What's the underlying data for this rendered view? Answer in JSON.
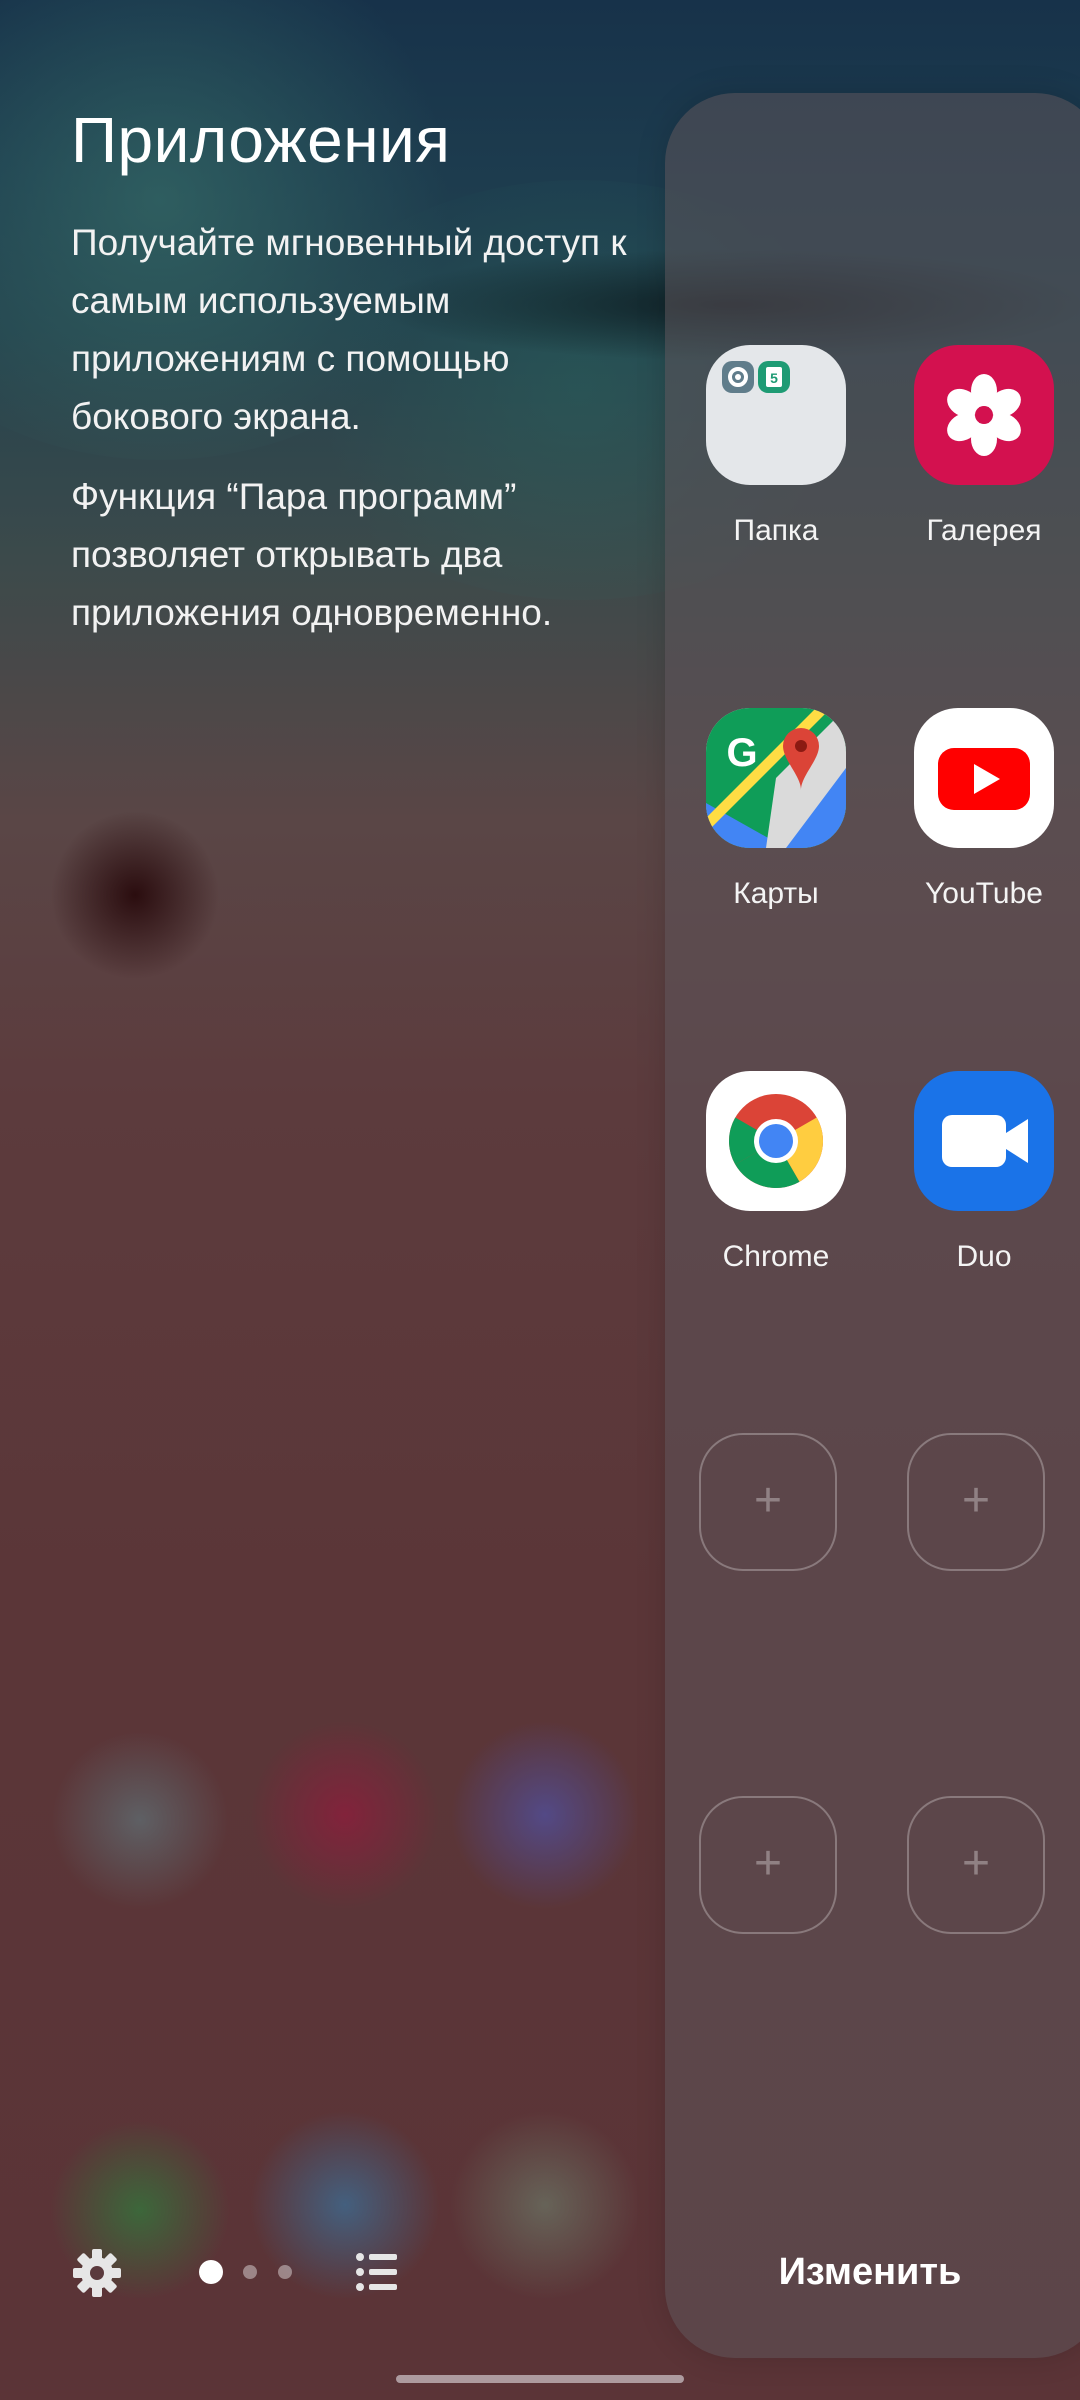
{
  "info": {
    "title": "Приложения",
    "paragraph1": "Получайте мгновенный доступ к самым используемым приложениям с помощью бокового экрана.",
    "paragraph2": "Функция “Пара программ” позволяет открывать два приложения одновременно."
  },
  "panel": {
    "apps": [
      {
        "label": "Папка",
        "icon": "folder-icon"
      },
      {
        "label": "Галерея",
        "icon": "gallery-icon"
      },
      {
        "label": "Карты",
        "icon": "maps-icon"
      },
      {
        "label": "YouTube",
        "icon": "youtube-icon"
      },
      {
        "label": "Chrome",
        "icon": "chrome-icon"
      },
      {
        "label": "Duo",
        "icon": "duo-icon"
      }
    ],
    "empty_slot_symbol": "+",
    "folder_badge_text": "5"
  },
  "bottom": {
    "edit_label": "Изменить",
    "page_indicator": {
      "pages": 3,
      "current": 1
    }
  },
  "colors": {
    "gallery": "#d3114f",
    "youtube": "#ff0000",
    "duo": "#1a73e8",
    "maps_green": "#0f9d58",
    "maps_blue": "#4285f4"
  }
}
